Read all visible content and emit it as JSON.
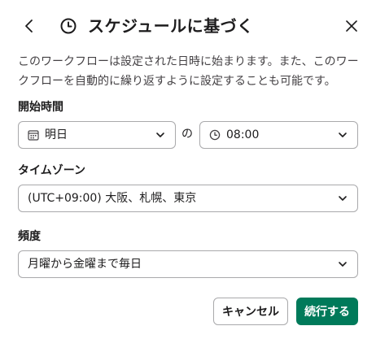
{
  "dialog": {
    "title": "スケジュールに基づく",
    "description": "このワークフローは設定された日時に始まります。また、このワークフローを自動的に繰り返すように設定することも可能です。"
  },
  "start_time": {
    "label": "開始時間",
    "date_value": "明日",
    "separator": "の",
    "time_value": "08:00"
  },
  "timezone": {
    "label": "タイムゾーン",
    "value": "(UTC+09:00) 大阪、札幌、東京"
  },
  "frequency": {
    "label": "頻度",
    "value": "月曜から金曜まで毎日"
  },
  "footer": {
    "cancel_label": "キャンセル",
    "continue_label": "続行する"
  },
  "colors": {
    "primary": "#007a5a",
    "text": "#1d1c1d",
    "muted_text": "#454245",
    "border": "#a9a9ab"
  },
  "icons": {
    "back": "chevron-left-icon",
    "header": "clock-icon",
    "close": "close-icon",
    "date": "calendar-icon",
    "time": "clock-icon",
    "dropdown": "chevron-down-icon"
  }
}
